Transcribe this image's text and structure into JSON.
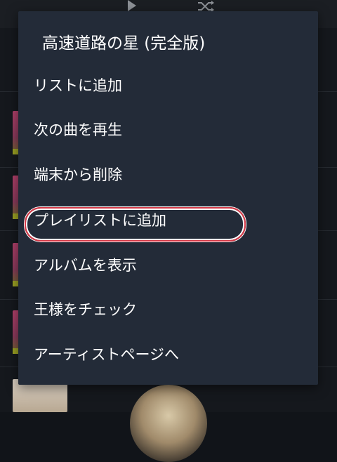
{
  "menu": {
    "title": "高速道路の星 (完全版)",
    "items": [
      {
        "label": "リストに追加"
      },
      {
        "label": "次の曲を再生"
      },
      {
        "label": "端末から削除"
      },
      {
        "label": "プレイリストに追加",
        "highlighted": true
      },
      {
        "label": "アルバムを表示"
      },
      {
        "label": "王様をチェック"
      },
      {
        "label": "アーティストページへ"
      }
    ]
  },
  "colors": {
    "menu_bg": "#232b38",
    "menu_text": "#ffffff",
    "highlight_ring": "#d63a48",
    "app_bg": "#15181d"
  },
  "icons": {
    "top_left": "play-icon",
    "top_right": "shuffle-icon"
  }
}
